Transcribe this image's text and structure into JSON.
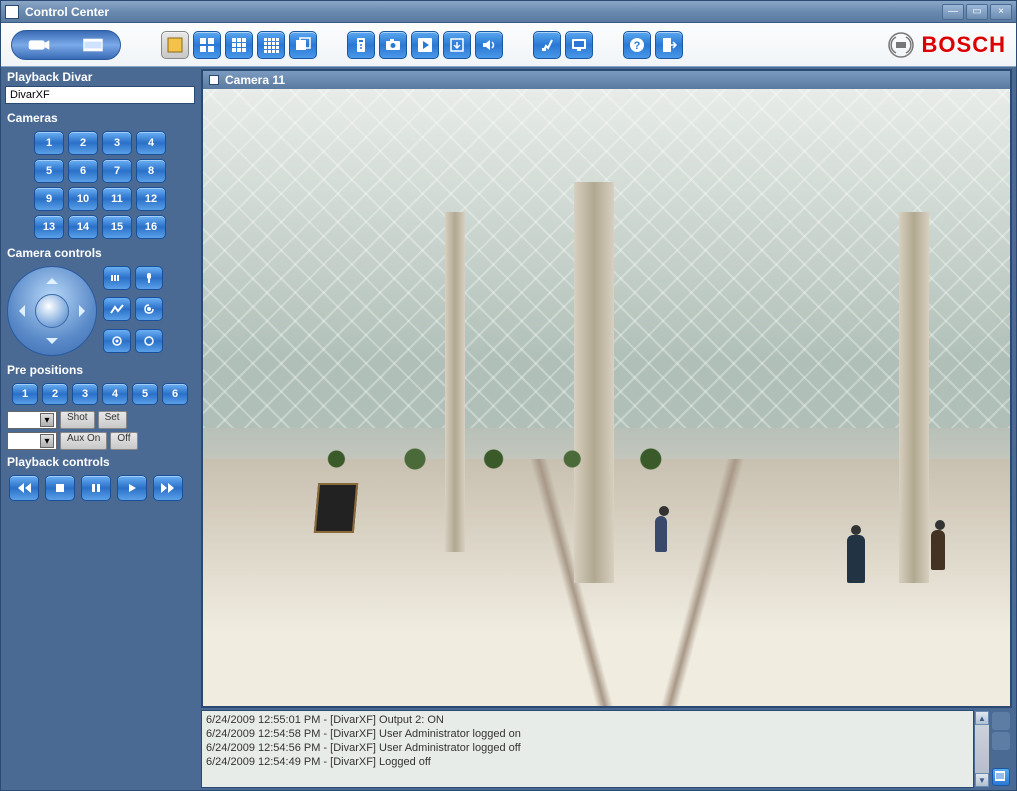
{
  "window": {
    "title": "Control Center"
  },
  "brand": {
    "name": "BOSCH"
  },
  "sidebar": {
    "playback_header": "Playback Divar",
    "device_name": "DivarXF",
    "cameras_header": "Cameras",
    "camera_numbers": [
      "1",
      "2",
      "3",
      "4",
      "5",
      "6",
      "7",
      "8",
      "9",
      "10",
      "11",
      "12",
      "13",
      "14",
      "15",
      "16"
    ],
    "camera_controls_header": "Camera controls",
    "pre_header": "Pre positions",
    "pre_numbers": [
      "1",
      "2",
      "3",
      "4",
      "5",
      "6"
    ],
    "shot_label": "Shot",
    "set_label": "Set",
    "auxon_label": "Aux On",
    "off_label": "Off",
    "playback_controls_header": "Playback controls"
  },
  "video": {
    "title": "Camera 11"
  },
  "log": {
    "lines": [
      "6/24/2009 12:55:01 PM - [DivarXF] Output 2: ON",
      "6/24/2009 12:54:58 PM - [DivarXF] User Administrator logged on",
      "6/24/2009 12:54:56 PM - [DivarXF] User Administrator logged off",
      "6/24/2009 12:54:49 PM - [DivarXF] Logged off"
    ]
  }
}
